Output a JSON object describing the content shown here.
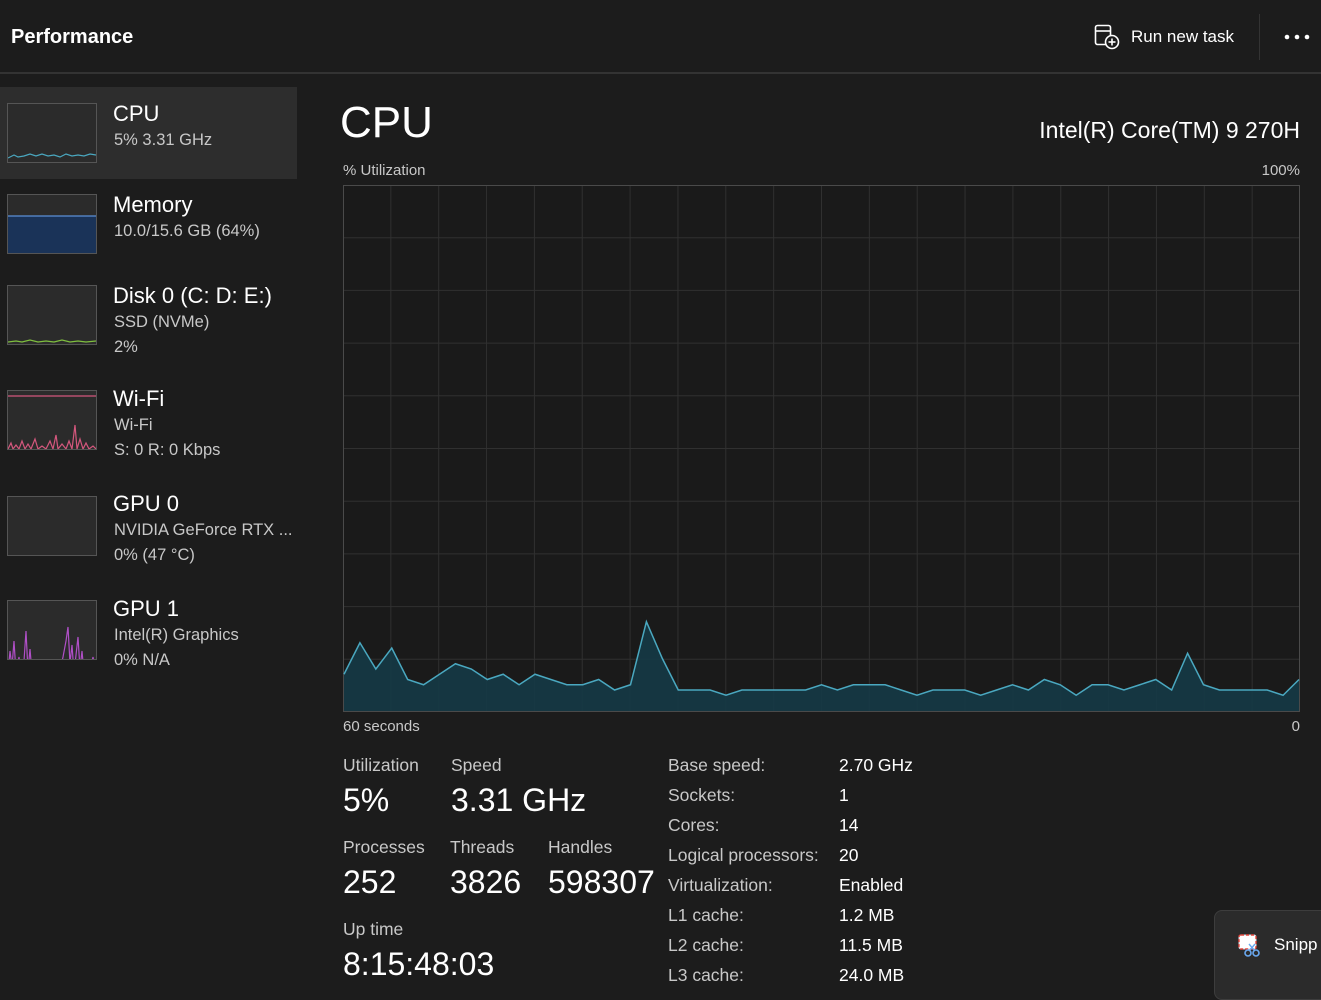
{
  "header": {
    "title": "Performance",
    "run_new_task_label": "Run new task",
    "more_icon": "more-horizontal-icon"
  },
  "sidebar": {
    "items": [
      {
        "name": "CPU",
        "line1": "5%  3.31 GHz",
        "line2": "",
        "color": "#4aa8c0",
        "active": true
      },
      {
        "name": "Memory",
        "line1": "10.0/15.6 GB (64%)",
        "line2": "",
        "color": "#5b8fd6",
        "fill_percent": 64
      },
      {
        "name": "Disk 0 (C: D: E:)",
        "line1": "SSD (NVMe)",
        "line2": "2%",
        "color": "#7fbf3f"
      },
      {
        "name": "Wi-Fi",
        "line1": "Wi-Fi",
        "line2": "S: 0  R: 0 Kbps",
        "color": "#d4577d"
      },
      {
        "name": "GPU 0",
        "line1": "NVIDIA GeForce RTX ...",
        "line2": "0%  (47 °C)",
        "color": "#b04fc7"
      },
      {
        "name": "GPU 1",
        "line1": "Intel(R) Graphics",
        "line2": "0%  N/A",
        "color": "#b04fc7"
      }
    ]
  },
  "main": {
    "title": "CPU",
    "model": "Intel(R) Core(TM) 9 270H",
    "graph_top_left": "% Utilization",
    "graph_top_right": "100%",
    "graph_bottom_left": "60 seconds",
    "graph_bottom_right": "0",
    "stats": {
      "utilization_label": "Utilization",
      "utilization_value": "5%",
      "speed_label": "Speed",
      "speed_value": "3.31 GHz",
      "processes_label": "Processes",
      "processes_value": "252",
      "threads_label": "Threads",
      "threads_value": "3826",
      "handles_label": "Handles",
      "handles_value": "598307",
      "uptime_label": "Up time",
      "uptime_value": "8:15:48:03"
    },
    "info": [
      {
        "label": "Base speed:",
        "value": "2.70 GHz"
      },
      {
        "label": "Sockets:",
        "value": "1"
      },
      {
        "label": "Cores:",
        "value": "14"
      },
      {
        "label": "Logical processors:",
        "value": "20"
      },
      {
        "label": "Virtualization:",
        "value": "Enabled"
      },
      {
        "label": "L1 cache:",
        "value": "1.2 MB"
      },
      {
        "label": "L2 cache:",
        "value": "11.5 MB"
      },
      {
        "label": "L3 cache:",
        "value": "24.0 MB"
      }
    ]
  },
  "chart_data": {
    "type": "area",
    "title": "CPU",
    "xlabel": "60 seconds",
    "ylabel": "% Utilization",
    "xlim": [
      0,
      60
    ],
    "ylim": [
      0,
      100
    ],
    "grid": true,
    "series": [
      {
        "color": "#4aa8c0",
        "values": [
          7,
          13,
          8,
          12,
          6,
          5,
          7,
          9,
          8,
          6,
          7,
          5,
          7,
          6,
          5,
          5,
          6,
          4,
          5,
          17,
          10,
          4,
          4,
          4,
          3,
          4,
          4,
          4,
          4,
          4,
          5,
          4,
          5,
          5,
          5,
          4,
          3,
          4,
          4,
          4,
          3,
          4,
          5,
          4,
          6,
          5,
          3,
          5,
          5,
          4,
          5,
          6,
          4,
          11,
          5,
          4,
          4,
          4,
          4,
          3,
          6
        ]
      }
    ]
  },
  "snipping": {
    "label": "Snipp",
    "icon": "snipping-tool-icon"
  }
}
